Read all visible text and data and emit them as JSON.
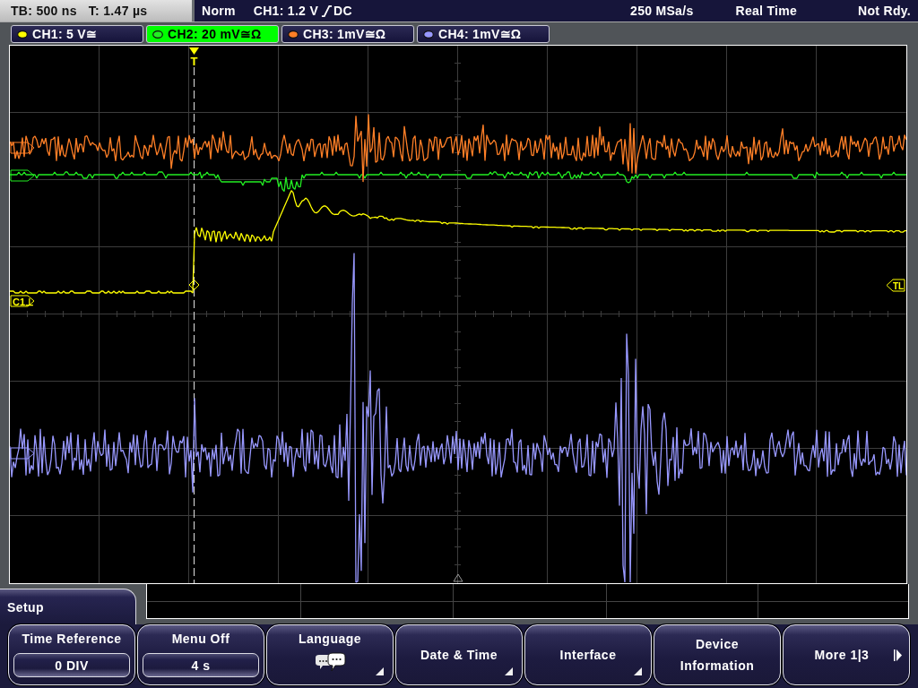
{
  "status_bar": {
    "timebase": "TB: 500 ns",
    "trigger_time": "T: 1.47 µs",
    "trigger_mode": "Norm",
    "trigger_source": "CH1: 1.2 V",
    "trigger_coupling": "DC",
    "sample_rate": "250 MSa/s",
    "acquisition": "Real Time",
    "status": "Not Rdy."
  },
  "channels": [
    {
      "label": "CH1: 5 V≅",
      "selected": false,
      "color": "#ffff00",
      "marker": "C1⊥"
    },
    {
      "label": "CH2: 20 mV≅Ω",
      "selected": true,
      "color": "#22ee22"
    },
    {
      "label": "CH3: 1mV≅Ω",
      "selected": false,
      "color": "#ff7f27"
    },
    {
      "label": "CH4: 1mV≅Ω",
      "selected": false,
      "color": "#9898ff"
    }
  ],
  "display": {
    "trigger_marker": "T",
    "trigger_level_marker": "TL"
  },
  "menu": {
    "title": "Setup",
    "softkeys": [
      {
        "kind": "value",
        "label": "Time Reference",
        "value": "0 DIV"
      },
      {
        "kind": "value",
        "label": "Menu Off",
        "value": "4 s"
      },
      {
        "kind": "language",
        "label": "Language"
      },
      {
        "kind": "submenu",
        "label": "Date & Time"
      },
      {
        "kind": "submenu",
        "label": "Interface"
      },
      {
        "kind": "plain",
        "label": "Device Information"
      },
      {
        "kind": "next",
        "label": "More 1|3"
      }
    ]
  }
}
